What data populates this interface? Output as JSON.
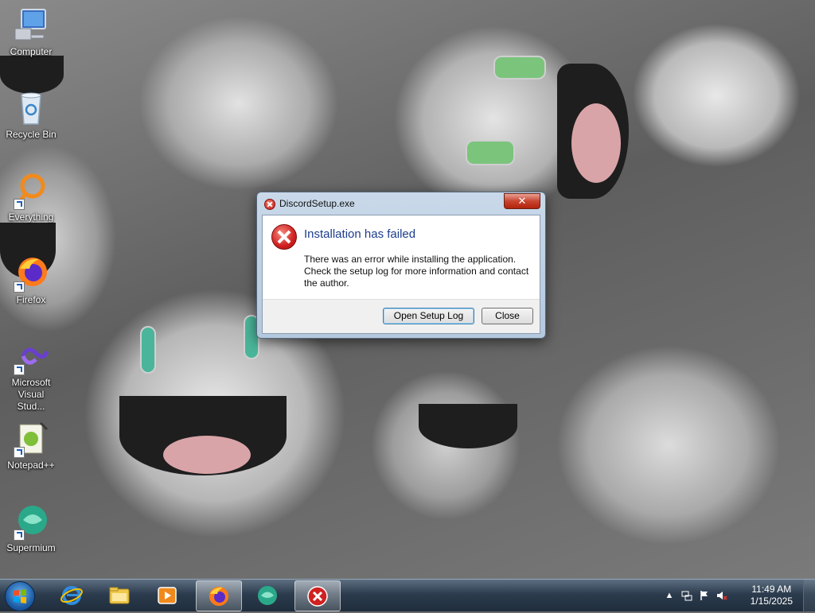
{
  "desktop": {
    "icons": [
      {
        "label": "Computer",
        "icon": "computer-icon"
      },
      {
        "label": "Recycle Bin",
        "icon": "recycle-bin-icon"
      },
      {
        "label": "Everything",
        "icon": "everything-icon"
      },
      {
        "label": "Firefox",
        "icon": "firefox-icon"
      },
      {
        "label": "Microsoft Visual Stud...",
        "icon": "visual-studio-icon"
      },
      {
        "label": "Notepad++",
        "icon": "notepad-plus-plus-icon"
      },
      {
        "label": "Supermium",
        "icon": "supermium-icon"
      }
    ]
  },
  "dialog": {
    "title": "DiscordSetup.exe",
    "close_glyph": "✕",
    "heading": "Installation has failed",
    "message": "There was an error while installing the application. Check the setup log for more information and contact the author.",
    "buttons": {
      "open_log": "Open Setup Log",
      "close": "Close"
    }
  },
  "taskbar": {
    "pinned": [
      {
        "icon": "internet-explorer-icon"
      },
      {
        "icon": "file-explorer-icon"
      },
      {
        "icon": "media-player-icon"
      },
      {
        "icon": "firefox-icon",
        "active": true
      },
      {
        "icon": "supermium-icon"
      },
      {
        "icon": "error-icon",
        "active": true
      }
    ],
    "tray": {
      "time": "11:49 AM",
      "date": "1/15/2025",
      "icons": [
        "show-hidden-icons-icon",
        "network-icon",
        "action-center-flag-icon",
        "volume-muted-icon"
      ]
    }
  },
  "colors": {
    "heading": "#1c3c8c",
    "error_red": "#d02020",
    "taskbar": "#2c3c4e"
  }
}
